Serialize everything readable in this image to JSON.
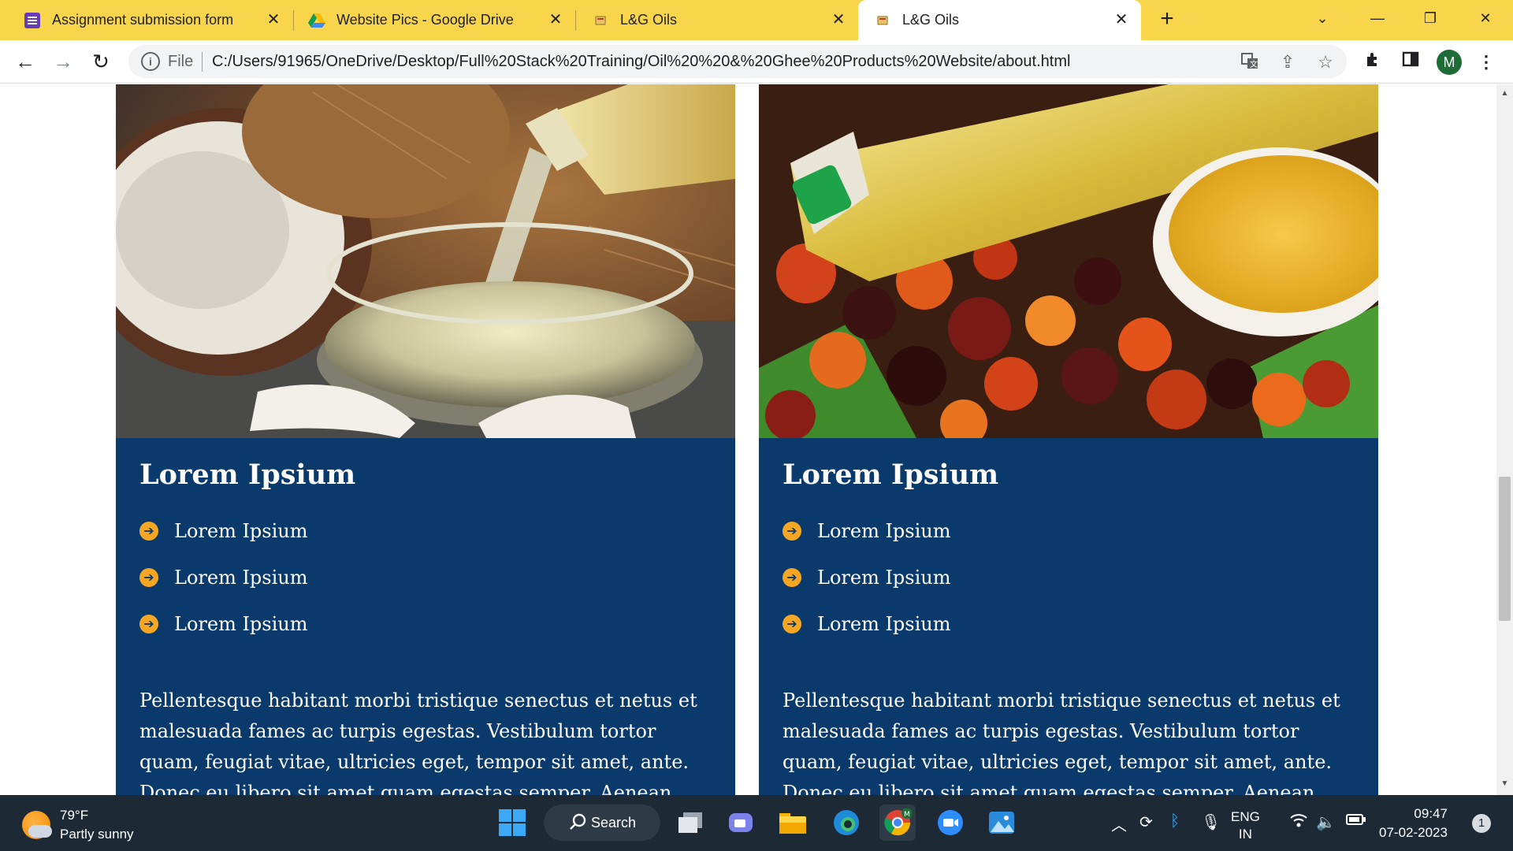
{
  "tabs": [
    {
      "title": "Assignment submission form",
      "icon": "forms-icon"
    },
    {
      "title": "Website Pics - Google Drive",
      "icon": "google-drive-icon"
    },
    {
      "title": "L&G Oils",
      "icon": "page-favicon"
    },
    {
      "title": "L&G Oils",
      "icon": "page-favicon",
      "active": true
    }
  ],
  "toolbar": {
    "file_label": "File",
    "url": "C:/Users/91965/OneDrive/Desktop/Full%20Stack%20Training/Oil%20%20&%20Ghee%20Products%20Website/about.html",
    "profile_initial": "M"
  },
  "cards": [
    {
      "image": "coconut-oil-image",
      "title": "Lorem Ipsium",
      "features": [
        "Lorem Ipsium",
        "Lorem Ipsium",
        "Lorem Ipsium"
      ],
      "text": "Pellentesque habitant morbi tristique senectus et netus et malesuada fames ac turpis egestas. Vestibulum tortor quam, feugiat vitae, ultricies eget, tempor sit amet, ante. Donec eu libero sit amet quam egestas semper. Aenean ultricies mi vitae est. Mauris placerat"
    },
    {
      "image": "palm-oil-image",
      "title": "Lorem Ipsium",
      "features": [
        "Lorem Ipsium",
        "Lorem Ipsium",
        "Lorem Ipsium"
      ],
      "text": "Pellentesque habitant morbi tristique senectus et netus et malesuada fames ac turpis egestas. Vestibulum tortor quam, feugiat vitae, ultricies eget, tempor sit amet, ante. Donec eu libero sit amet quam egestas semper. Aenean ultricies mi vitae est. Mauris placerat"
    }
  ],
  "taskbar": {
    "temperature": "79°F",
    "weather": "Partly sunny",
    "search_label": "Search",
    "language": "ENG",
    "region": "IN",
    "time": "09:47",
    "date": "07-02-2023",
    "notification_count": "1"
  },
  "colors": {
    "tabstrip": "#f8d54b",
    "card_bg": "#0a3a6b",
    "bullet": "#f5a623",
    "taskbar": "#1d2a36"
  }
}
